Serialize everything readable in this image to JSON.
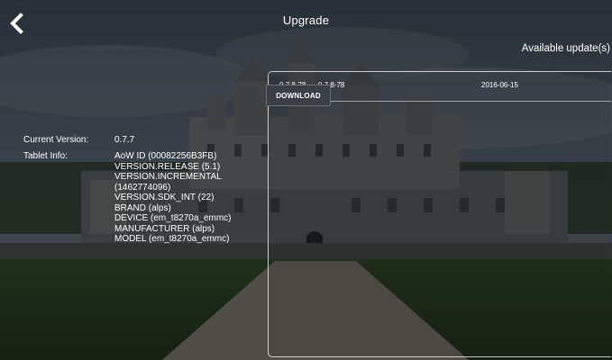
{
  "header": {
    "title": "Upgrade",
    "back_icon": "chevron-left-icon"
  },
  "updates": {
    "heading": "Available update(s)",
    "items": [
      {
        "version_a": "0.7.8-78",
        "version_b": "0.7.8-78",
        "date": "2016-06-15",
        "action": "DOWNLOAD"
      }
    ]
  },
  "device_info": {
    "current_version_label": "Current Version:",
    "current_version_value": "0.7.7",
    "tablet_info_label": "Tablet Info:",
    "tablet_info_lines": [
      "AoW ID (00082256B3FB)",
      "VERSION.RELEASE (5.1)",
      "VERSION.INCREMENTAL (1462774096)",
      "VERSION.SDK_INT (22)",
      "BRAND (alps)",
      "DEVICE (em_t8270a_emmc)",
      "MANUFACTURER (alps)",
      "MODEL (em_t8270a_emmc)"
    ]
  }
}
